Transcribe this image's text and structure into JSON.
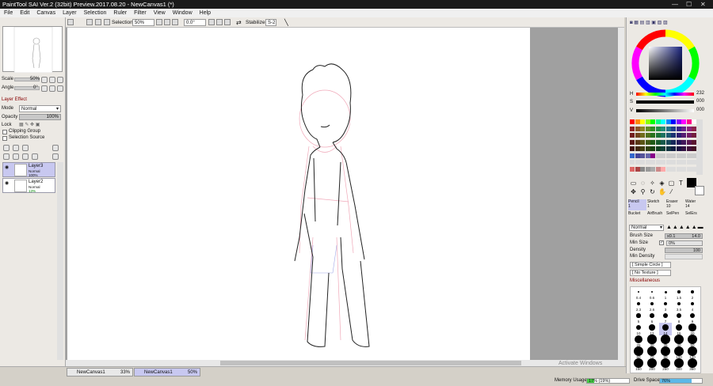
{
  "window": {
    "title": "PaintTool SAI Ver.2 (32bit) Preview.2017.08.20 - NewCanvas1 (*)",
    "minimize": "—",
    "maximize": "☐",
    "close": "✕"
  },
  "menu": [
    "File",
    "Edit",
    "Canvas",
    "Layer",
    "Selection",
    "Ruler",
    "Filter",
    "View",
    "Window",
    "Help"
  ],
  "toolbar": {
    "selection_label": "Selection",
    "zoom": "50%",
    "angle": "0.0°",
    "stabilizer_label": "Stabilizer",
    "stabilizer_value": "S-2"
  },
  "navigator": {
    "scale_label": "Scale",
    "scale_value": "50%",
    "angle_label": "Angle",
    "angle_value": "0°"
  },
  "layer_panel": {
    "effect_label": "Layer Effect",
    "mode_label": "Mode",
    "mode_value": "Normal",
    "opacity_label": "Opacity",
    "opacity_value": "100%",
    "lock_label": "Lock",
    "clipping_label": "Clipping Group",
    "selection_source_label": "Selection Source",
    "layers": [
      {
        "name": "Layer3",
        "mode": "Normal",
        "opacity": "100%",
        "selected": true
      },
      {
        "name": "Layer2",
        "mode": "Normal",
        "opacity": "13%",
        "selected": false
      }
    ]
  },
  "tabs": [
    {
      "name": "NewCanvas1",
      "zoom": "33%"
    },
    {
      "name": "NewCanvas1",
      "zoom": "50%"
    }
  ],
  "status": {
    "memory_label": "Memory Usage",
    "memory_value": "17% (19%)",
    "memory_fraction": 0.17,
    "drive_label": "Drive Space",
    "drive_value": "76%",
    "drive_fraction": 0.76
  },
  "watermark": "Activate Windows",
  "color": {
    "h_label": "H",
    "h_value": "232",
    "s_label": "S",
    "s_value": "000",
    "v_label": "V",
    "v_value": "000",
    "primary": "#000000",
    "secondary": "#ffffff",
    "hue_color": "#1a237e"
  },
  "tools": {
    "text_icon": "T",
    "brushes": [
      {
        "name": "Pencil",
        "size": "1"
      },
      {
        "name": "Sketch",
        "size": "1"
      },
      {
        "name": "Eraser",
        "size": "10"
      },
      {
        "name": "Water",
        "size": "14"
      },
      {
        "name": "Bucket",
        "size": ""
      },
      {
        "name": "AirBrush",
        "size": ""
      },
      {
        "name": "SelPen",
        "size": ""
      },
      {
        "name": "SelErs",
        "size": ""
      }
    ]
  },
  "brush_settings": {
    "blend_mode": "Normal",
    "size_label": "Brush Size",
    "size_mult": "x0.1",
    "size_value": "14.0",
    "min_size_label": "Min Size",
    "min_size_value": "0%",
    "density_label": "Density",
    "density_value": "100",
    "min_density_label": "Min Density",
    "circle": "[ Simple Circle ]",
    "texture": "[ No Texture ]",
    "misc_label": "Miscellaneous"
  },
  "brush_sizes": [
    "0.4",
    "0.6",
    "1",
    "1.5",
    "2",
    "2.3",
    "2.6",
    "3",
    "3.5",
    "4",
    "5",
    "6",
    "7",
    "8",
    "9",
    "10",
    "12",
    "14",
    "16",
    "20",
    "25",
    "30",
    "35",
    "40",
    "50",
    "60",
    "70",
    "80",
    "100",
    "120",
    "150",
    "200",
    "250",
    "300",
    "350",
    "400",
    "450",
    "500"
  ]
}
